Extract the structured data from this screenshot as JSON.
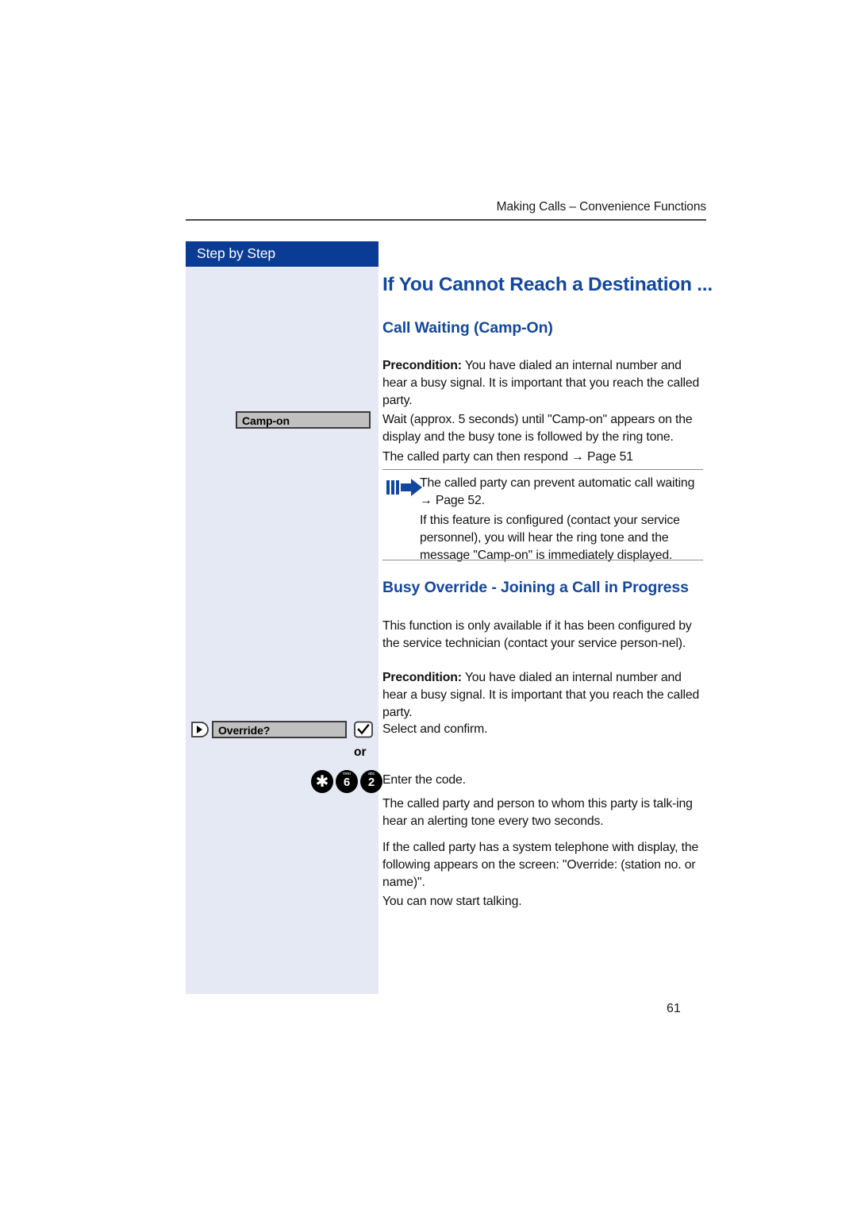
{
  "header": {
    "running_head": "Making Calls – Convenience Functions"
  },
  "sidebar": {
    "band_label": "Step by Step",
    "display_camp_on": "Camp-on",
    "display_override": "Override?",
    "prev_icon": "prev-softkey-icon",
    "ok_icon": "ok-checkmark-icon",
    "or_label": "or",
    "keys": [
      {
        "sup": "",
        "num": "✱",
        "name": "key-star"
      },
      {
        "sup": "mno",
        "num": "6",
        "name": "key-6"
      },
      {
        "sup": "abc",
        "num": "2",
        "name": "key-2"
      }
    ]
  },
  "main": {
    "title": "If You Cannot Reach a Destination ...",
    "section_one": {
      "subtitle": "Call Waiting (Camp-On)",
      "precondition_label": "Precondition:",
      "precondition_text": " You have dialed an internal number and hear a busy signal. It is important that you reach the called party.",
      "wait_text": "Wait (approx. 5 seconds) until \"Camp-on\" appears on the display and the busy tone is followed by the ring tone.",
      "respond_text": "The called party can then respond → Page 51",
      "note_icon": "note-arrow-icon",
      "note_text": "The called party can prevent automatic call waiting → Page 52.",
      "note_text_2": "If this feature is configured (contact your service personnel), you will hear the ring tone and the message \"Camp-on\" is immediately displayed."
    },
    "section_two": {
      "subtitle": "Busy Override - Joining a Call in Progress",
      "availability_text": "This function is only available if it has been configured by the service technician (contact your service person-nel).",
      "precondition_label": "Precondition:",
      "precondition_text": " You have dialed an internal number and hear a busy signal. It is important that you reach the called party.",
      "select_text": "Select and confirm.",
      "enter_code_text": "Enter the code.",
      "alerting_text": "The called party and person to whom this party is talk-ing hear an alerting tone every two seconds.",
      "display_text": "If the called party has a system telephone with display, the following appears on the screen: \"Override: (station no. or name)\".",
      "start_talking_text": "You can now start talking."
    }
  },
  "footer": {
    "page_number": "61"
  },
  "colors": {
    "accent_blue": "#12479e",
    "band_blue": "#0b3c95",
    "sidebar_bg": "#e5e9f4",
    "display_gray": "#c0c0c0"
  }
}
